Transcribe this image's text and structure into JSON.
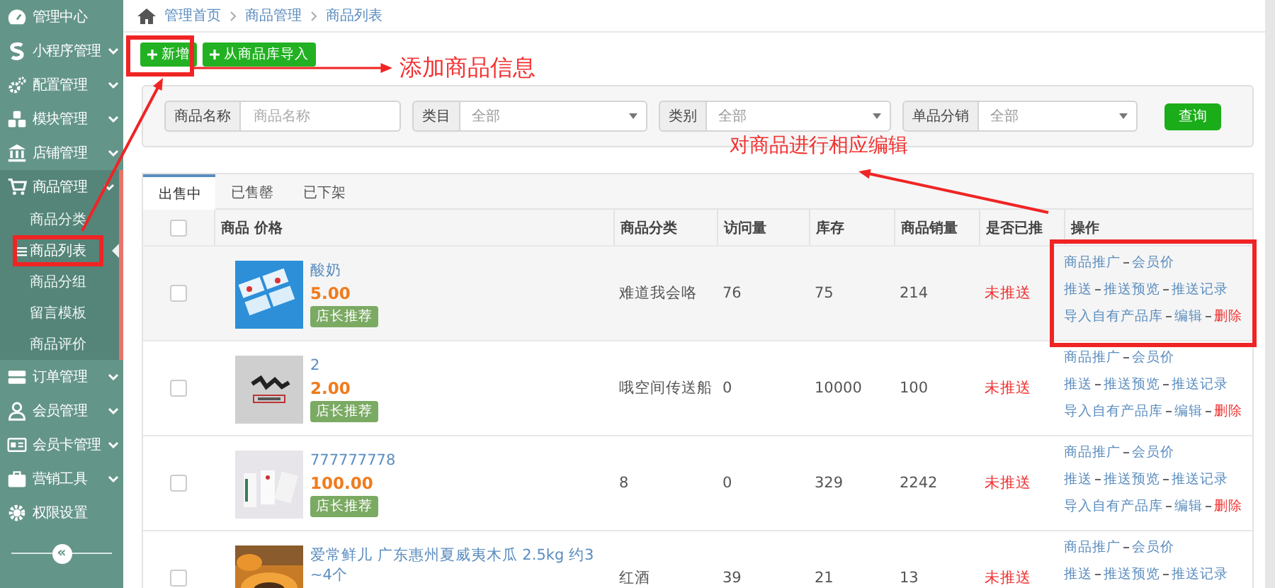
{
  "sidebar": {
    "items": [
      {
        "label": "管理中心",
        "expandable": false,
        "expanded": false
      },
      {
        "label": "小程序管理",
        "expandable": true,
        "expanded": false
      },
      {
        "label": "配置管理",
        "expandable": true,
        "expanded": false
      },
      {
        "label": "模块管理",
        "expandable": true,
        "expanded": false
      },
      {
        "label": "店铺管理",
        "expandable": true,
        "expanded": false
      },
      {
        "label": "商品管理",
        "expandable": true,
        "expanded": true,
        "children": [
          {
            "label": "商品分类",
            "selected": false,
            "highlighted": false
          },
          {
            "label": "商品列表",
            "selected": true,
            "highlighted": true
          },
          {
            "label": "商品分组",
            "selected": false,
            "highlighted": false
          },
          {
            "label": "留言模板",
            "selected": false,
            "highlighted": false
          },
          {
            "label": "商品评价",
            "selected": false,
            "highlighted": false
          }
        ]
      },
      {
        "label": "订单管理",
        "expandable": true,
        "expanded": false
      },
      {
        "label": "会员管理",
        "expandable": true,
        "expanded": false
      },
      {
        "label": "会员卡管理",
        "expandable": true,
        "expanded": false
      },
      {
        "label": "营销工具",
        "expandable": true,
        "expanded": false
      },
      {
        "label": "权限设置",
        "expandable": false,
        "expanded": false
      }
    ],
    "collapse_button": "«"
  },
  "breadcrumb": [
    "管理首页",
    "商品管理",
    "商品列表"
  ],
  "toolbar": {
    "buttons": [
      {
        "label": "新增",
        "highlighted": true
      },
      {
        "label": "从商品库导入",
        "highlighted": false
      }
    ]
  },
  "filters": [
    {
      "kind": "text",
      "label": "商品名称",
      "placeholder": "商品名称"
    },
    {
      "kind": "select",
      "label": "类目",
      "value": "全部"
    },
    {
      "kind": "select",
      "label": "类别",
      "value": "全部"
    },
    {
      "kind": "select",
      "label": "单品分销",
      "value": "全部"
    }
  ],
  "search_button": "查询",
  "tabs": [
    {
      "label": "出售中",
      "selected": true
    },
    {
      "label": "已售罄",
      "selected": false
    },
    {
      "label": "已下架",
      "selected": false
    }
  ],
  "table": {
    "select_all": {
      "checked": false
    },
    "columns": [
      "商品 价格",
      "商品分类",
      "访问量",
      "库存",
      "商品销量",
      "是否已推",
      "操作"
    ],
    "rows": [
      {
        "checked": false,
        "hovered": true,
        "highlighted": true,
        "name": "酸奶",
        "price": "5.00",
        "badge": "店长推荐",
        "category": "难道我会咯",
        "visits": "76",
        "stock": "75",
        "sales": "214",
        "push_status": "未推送",
        "actions": [
          [
            {
              "label": "商品推广",
              "kind": "link"
            },
            {
              "label": "会员价",
              "kind": "link"
            }
          ],
          [
            {
              "label": "推送",
              "kind": "link"
            },
            {
              "label": "推送预览",
              "kind": "link"
            },
            {
              "label": "推送记录",
              "kind": "link"
            }
          ],
          [
            {
              "label": "导入自有产品库",
              "kind": "link"
            },
            {
              "label": "编辑",
              "kind": "link"
            },
            {
              "label": "删除",
              "kind": "danger"
            }
          ]
        ]
      },
      {
        "checked": false,
        "hovered": false,
        "highlighted": false,
        "name": "2",
        "price": "2.00",
        "badge": "店长推荐",
        "category": "哦空间传送船",
        "visits": "0",
        "stock": "10000",
        "sales": "100",
        "push_status": "未推送",
        "actions": [
          [
            {
              "label": "商品推广",
              "kind": "link"
            },
            {
              "label": "会员价",
              "kind": "link"
            }
          ],
          [
            {
              "label": "推送",
              "kind": "link"
            },
            {
              "label": "推送预览",
              "kind": "link"
            },
            {
              "label": "推送记录",
              "kind": "link"
            }
          ],
          [
            {
              "label": "导入自有产品库",
              "kind": "link"
            },
            {
              "label": "编辑",
              "kind": "link"
            },
            {
              "label": "删除",
              "kind": "danger"
            }
          ]
        ]
      },
      {
        "checked": false,
        "hovered": false,
        "highlighted": false,
        "name": "777777778",
        "price": "100.00",
        "badge": "店长推荐",
        "category": "8",
        "visits": "0",
        "stock": "329",
        "sales": "2242",
        "push_status": "未推送",
        "actions": [
          [
            {
              "label": "商品推广",
              "kind": "link"
            },
            {
              "label": "会员价",
              "kind": "link"
            }
          ],
          [
            {
              "label": "推送",
              "kind": "link"
            },
            {
              "label": "推送预览",
              "kind": "link"
            },
            {
              "label": "推送记录",
              "kind": "link"
            }
          ],
          [
            {
              "label": "导入自有产品库",
              "kind": "link"
            },
            {
              "label": "编辑",
              "kind": "link"
            },
            {
              "label": "删除",
              "kind": "danger"
            }
          ]
        ]
      },
      {
        "checked": false,
        "hovered": false,
        "highlighted": false,
        "name": "爱常鲜儿 广东惠州夏威夷木瓜 2.5kg 约3 ~4个",
        "category": "红酒",
        "visits": "39",
        "stock": "21",
        "sales": "13",
        "push_status": "未推送",
        "actions": [
          [
            {
              "label": "商品推广",
              "kind": "link"
            },
            {
              "label": "会员价",
              "kind": "link"
            }
          ],
          [
            {
              "label": "推送",
              "kind": "link"
            },
            {
              "label": "推送预览",
              "kind": "link"
            },
            {
              "label": "推送记录",
              "kind": "link"
            }
          ]
        ]
      }
    ]
  },
  "callouts": [
    {
      "text": "添加商品信息"
    },
    {
      "text": "对商品进行相应编辑"
    }
  ]
}
